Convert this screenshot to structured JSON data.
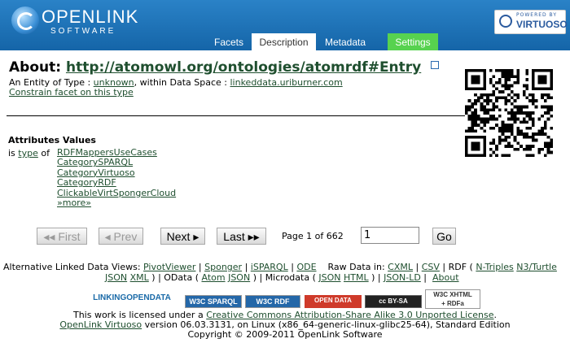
{
  "header": {
    "logo_main": "OPENLINK",
    "logo_sub": "SOFTWARE",
    "powered_by": "POWERED BY",
    "virtuoso": "VIRTUOSO"
  },
  "tabs": {
    "facets": "Facets",
    "description": "Description",
    "metadata": "Metadata",
    "settings": "Settings"
  },
  "about": {
    "label": "About:",
    "uri": "http://atomowl.org/ontologies/atomrdf#Entry"
  },
  "entity": {
    "prefix": "An Entity of Type :",
    "type": "unknown",
    "middle": ", within Data Space :",
    "space": "linkeddata.uriburner.com",
    "constrain": "Constrain facet on this type"
  },
  "attributes": {
    "header": "Attributes Values",
    "is": "is",
    "type": "type",
    "of": "of",
    "values": [
      "RDFMappersUseCases",
      "CategorySPARQL",
      "CategoryVirtuoso",
      "CategoryRDF",
      "ClickableVirtSpongerCloud",
      "»more»"
    ]
  },
  "pager": {
    "first": "◂◂ First",
    "prev": "◂ Prev",
    "next": "Next ▸",
    "last": "Last ▸▸",
    "page_label": "Page 1 of 662",
    "page_value": "1",
    "go": "Go"
  },
  "alt_views": {
    "label": "Alternative Linked Data Views:",
    "pivot": "PivotViewer",
    "sponger": "Sponger",
    "isparql": "iSPARQL",
    "ode": "ODE",
    "raw": "Raw Data in:",
    "cxml": "CXML",
    "csv": "CSV",
    "rdf_open": "RDF (",
    "ntriples": "N-Triples",
    "n3": "N3/Turtle",
    "json": "JSON",
    "xml": "XML",
    "odata_open": ") | OData (",
    "atom": "Atom",
    "json2": "JSON",
    "microdata_open": ") | Microdata (",
    "json3": "JSON",
    "html": "HTML",
    "close": ") |",
    "jsonld": "JSON-LD",
    "about": "About"
  },
  "badges": {
    "lod": "LINKINGOPENDATA",
    "sparql": "W3C SPARQL",
    "rdf": "W3C RDF",
    "opendata": "OPEN DATA",
    "ccbysa": "cc BY-SA",
    "xhtml1": "W3C XHTML",
    "xhtml2": "+ RDFa"
  },
  "footer": {
    "lic_prefix": "This work is licensed under a",
    "lic_link": "Creative Commons Attribution-Share Alike 3.0 Unported License",
    "lic_suffix": ".",
    "ver_link": "OpenLink Virtuoso",
    "ver_text": "version 06.03.3131, on Linux (x86_64-generic-linux-glibc25-64), Standard Edition",
    "copyright": "Copyright © 2009-2011 OpenLink Software"
  }
}
